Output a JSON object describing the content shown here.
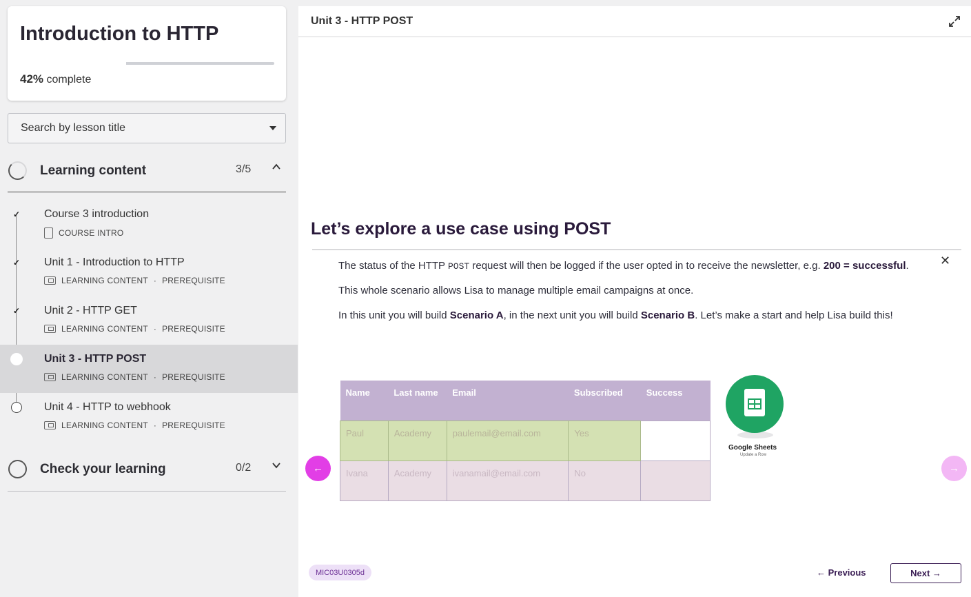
{
  "course": {
    "title": "Introduction to HTTP",
    "progress_percent": 42,
    "progress_value": "42%",
    "progress_suffix": " complete"
  },
  "search": {
    "placeholder": "Search by lesson title"
  },
  "sections": [
    {
      "label": "Learning content",
      "count": "3/5",
      "chevron": "up"
    },
    {
      "label": "Check your learning",
      "count": "0/2",
      "chevron": "down"
    }
  ],
  "lessons": [
    {
      "title": "Course 3 introduction",
      "type": "COURSE INTRO",
      "tag": "",
      "status": "done"
    },
    {
      "title": "Unit 1 - Introduction to HTTP",
      "type": "LEARNING CONTENT",
      "tag": "PREREQUISITE",
      "status": "done"
    },
    {
      "title": "Unit 2 - HTTP GET",
      "type": "LEARNING CONTENT",
      "tag": "PREREQUISITE",
      "status": "done"
    },
    {
      "title": "Unit 3 - HTTP POST",
      "type": "LEARNING CONTENT",
      "tag": "PREREQUISITE",
      "status": "current"
    },
    {
      "title": "Unit 4 - HTTP to webhook",
      "type": "LEARNING CONTENT",
      "tag": "PREREQUISITE",
      "status": "open"
    }
  ],
  "meta_separator": "·",
  "main": {
    "unit_title": "Unit 3 - HTTP POST",
    "heading": "Let’s explore a use case using POST",
    "para1": {
      "a": "The status of the HTTP ",
      "code": "POST",
      "b": " request will then be logged if the user opted in to receive the newsletter, e.g. ",
      "bold": "200 = successful",
      "c": "."
    },
    "para2": "This whole scenario allows Lisa to manage multiple email campaigns at once.",
    "para3": {
      "a": "In this unit you will build ",
      "bold1": "Scenario A",
      "b": ", in the next unit you will build ",
      "bold2": "Scenario B",
      "c": ". Let’s make a start and help Lisa build this!"
    },
    "table": {
      "headers": [
        "Name",
        "Last name",
        "Email",
        "Subscribed",
        "Success"
      ],
      "rows": [
        [
          "Paul",
          "Academy",
          "paulemail@email.com",
          "Yes",
          ""
        ],
        [
          "Ivana",
          "Academy",
          "ivanamail@email.com",
          "No",
          ""
        ]
      ]
    },
    "module": {
      "name": "Google Sheets",
      "action": "Update a Row"
    },
    "code_badge": "MIC03U0305d",
    "prev_label": "← Previous",
    "next_label": "Next →"
  },
  "colors": {
    "accent": "#e23ee6",
    "brand_dark": "#3a1d54",
    "sheets_green": "#1fa463"
  }
}
